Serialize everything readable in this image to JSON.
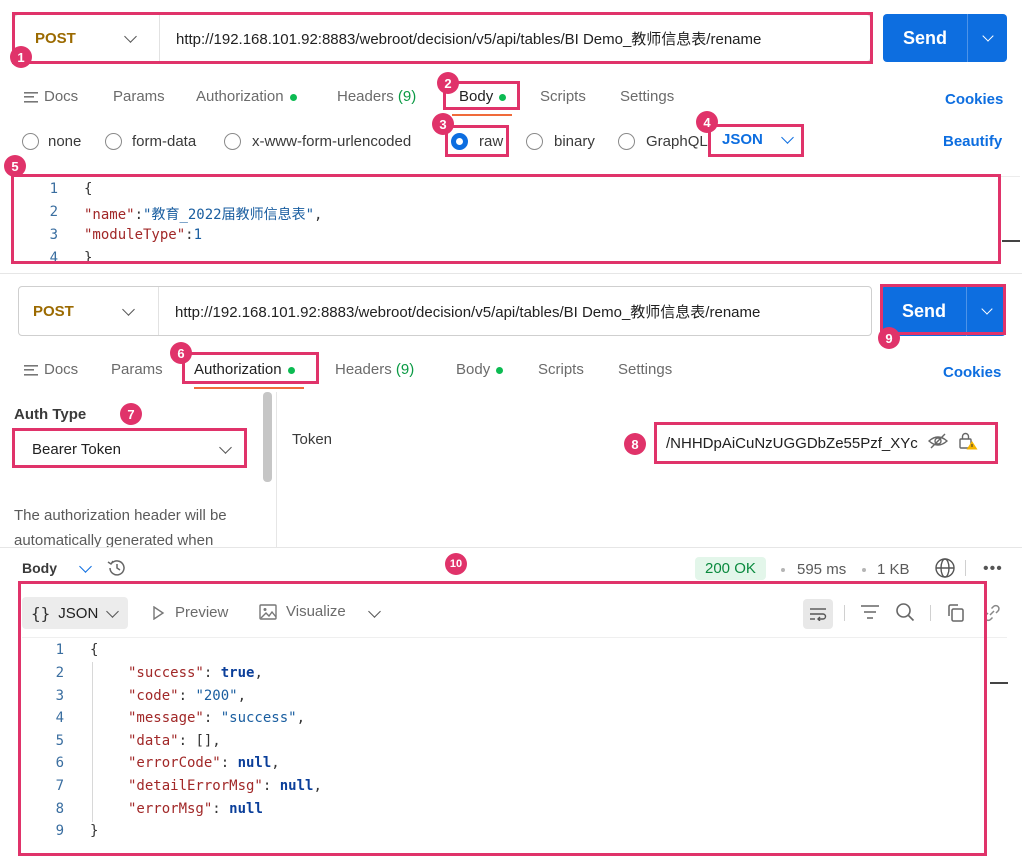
{
  "top_request": {
    "method": "POST",
    "url": "http://192.168.101.92:8883/webroot/decision/v5/api/tables/BI Demo_教师信息表/rename",
    "send": "Send",
    "tabs": {
      "docs": "Docs",
      "params": "Params",
      "authorization": "Authorization",
      "headers": "Headers",
      "headers_count": "(9)",
      "body": "Body",
      "scripts": "Scripts",
      "settings": "Settings"
    },
    "cookies": "Cookies",
    "body_types": {
      "none": "none",
      "form_data": "form-data",
      "urlencoded": "x-www-form-urlencoded",
      "raw": "raw",
      "binary": "binary",
      "graphql": "GraphQL"
    },
    "format": "JSON",
    "beautify": "Beautify",
    "code_lines": [
      "1",
      "2",
      "3",
      "4"
    ],
    "code": {
      "l1": "{",
      "l2_key": "\"name\"",
      "l2_sep": ":",
      "l2_val": "\"教育_2022届教师信息表\"",
      "l2_end": ",",
      "l3_key": "\"moduleType\"",
      "l3_sep": ":",
      "l3_val": "1",
      "l4": "}"
    }
  },
  "bottom_request": {
    "method": "POST",
    "url": "http://192.168.101.92:8883/webroot/decision/v5/api/tables/BI Demo_教师信息表/rename",
    "send": "Send",
    "tabs": {
      "docs": "Docs",
      "params": "Params",
      "authorization": "Authorization",
      "headers": "Headers",
      "headers_count": "(9)",
      "body": "Body",
      "scripts": "Scripts",
      "settings": "Settings"
    },
    "cookies": "Cookies",
    "auth_type_label": "Auth Type",
    "auth_type_value": "Bearer Token",
    "auth_note_1": "The authorization header will be",
    "auth_note_2": "automatically generated when",
    "token_label": "Token",
    "token_value": "/NHHDpAiCuNzUGGDbZe55Pzf_XYc"
  },
  "response": {
    "body_label": "Body",
    "status": "200 OK",
    "time": "595 ms",
    "size": "1 KB",
    "view_json": "JSON",
    "preview": "Preview",
    "visualize": "Visualize",
    "line_numbers": [
      "1",
      "2",
      "3",
      "4",
      "5",
      "6",
      "7",
      "8",
      "9"
    ],
    "json": {
      "open": "{",
      "close": "}",
      "success_key": "\"success\"",
      "success_val": "true",
      "code_key": "\"code\"",
      "code_val": "\"200\"",
      "message_key": "\"message\"",
      "message_val": "\"success\"",
      "data_key": "\"data\"",
      "data_val": "[]",
      "errorCode_key": "\"errorCode\"",
      "errorCode_val": "null",
      "detailErrorMsg_key": "\"detailErrorMsg\"",
      "detailErrorMsg_val": "null",
      "errorMsg_key": "\"errorMsg\"",
      "errorMsg_val": "null"
    }
  },
  "markers": [
    "1",
    "2",
    "3",
    "4",
    "5",
    "6",
    "7",
    "8",
    "9",
    "10"
  ],
  "colors": {
    "accent": "#0d6ee0",
    "highlight": "#e0336a",
    "method": "#9b6a00",
    "ok": "#0cbb52"
  }
}
